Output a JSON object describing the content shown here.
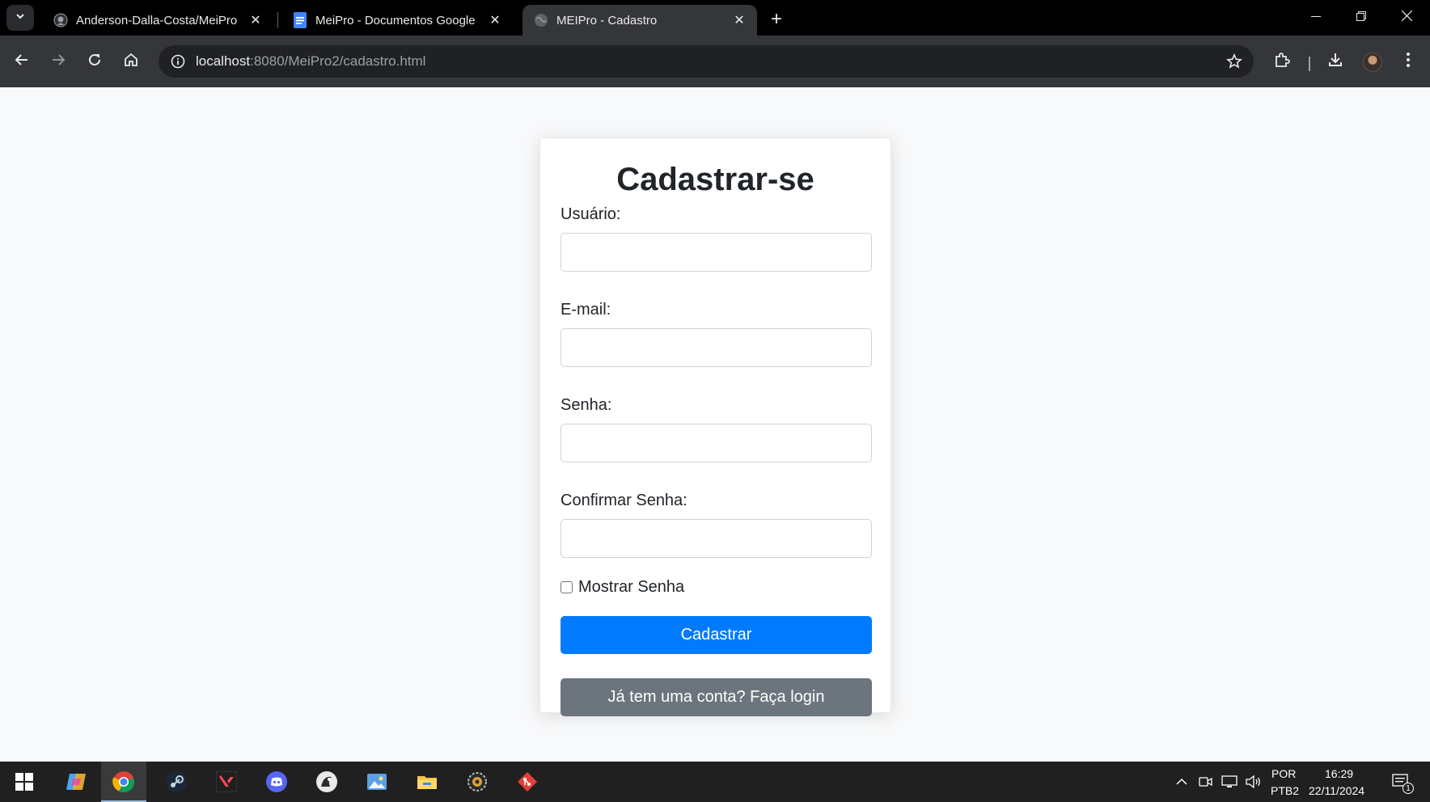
{
  "browser": {
    "tabs": [
      {
        "title": "Anderson-Dalla-Costa/MeiPro",
        "icon": "github-icon",
        "active": false
      },
      {
        "title": "MeiPro - Documentos Google",
        "icon": "google-docs-icon",
        "active": false
      },
      {
        "title": "MEIPro - Cadastro",
        "icon": "globe-icon",
        "active": true
      }
    ],
    "url_host": "localhost",
    "url_rest": ":8080/MeiPro2/cadastro.html"
  },
  "form": {
    "title": "Cadastrar-se",
    "username_label": "Usuário:",
    "email_label": "E-mail:",
    "password_label": "Senha:",
    "confirm_label": "Confirmar Senha:",
    "show_password_label": "Mostrar Senha",
    "show_password_checked": false,
    "submit_label": "Cadastrar",
    "login_label": "Já tem uma conta? Faça login"
  },
  "taskbar": {
    "apps": [
      "windows-start-icon",
      "copilot-icon",
      "chrome-icon",
      "steam-icon",
      "valorant-icon",
      "discord-icon",
      "game-launcher-icon",
      "image-viewer-icon",
      "file-explorer-icon",
      "settings-gear-icon",
      "git-icon"
    ],
    "lang_top": "POR",
    "lang_bottom": "PTB2",
    "time": "16:29",
    "date": "22/11/2024",
    "notif_count": "1"
  },
  "colors": {
    "primary": "#007bff",
    "secondary": "#6c757d",
    "page_bg": "#f8f9fa",
    "toolbar_bg": "#35363a"
  }
}
